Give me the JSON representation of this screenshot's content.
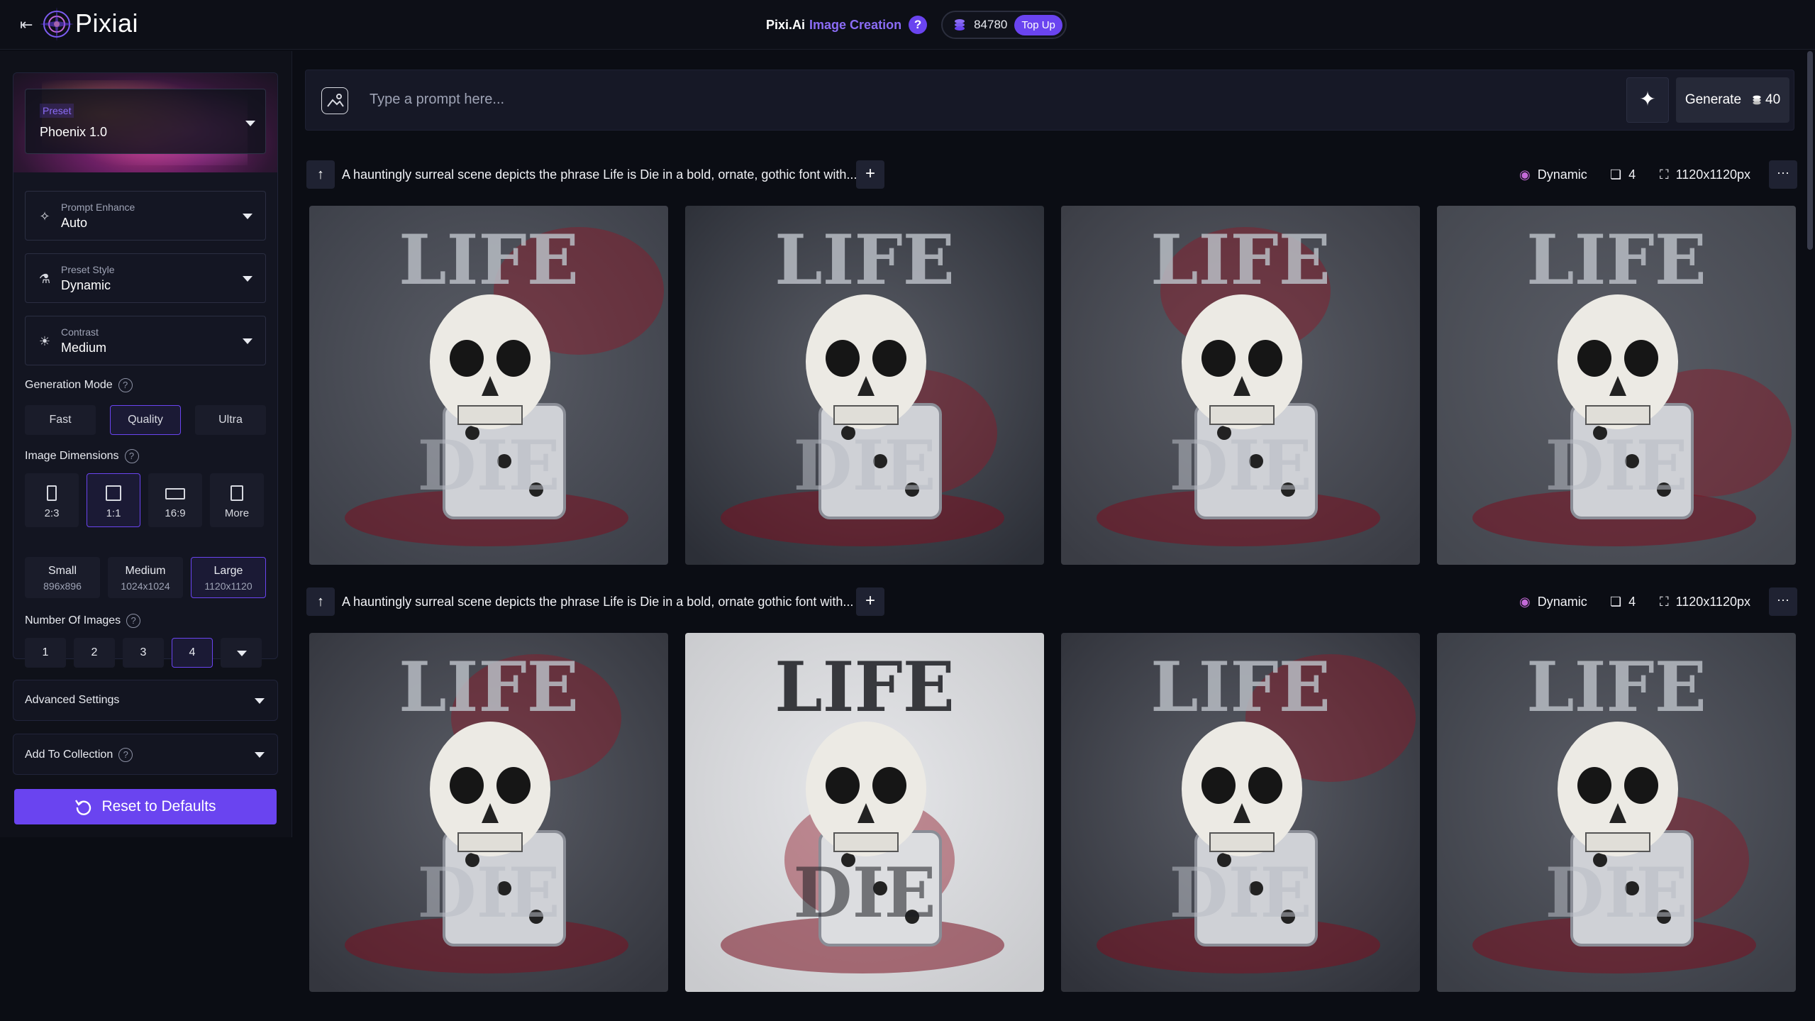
{
  "app": {
    "brand": "Pixiai",
    "title": "Pixi.Ai",
    "subtitle": "Image Creation",
    "help": "?",
    "credits": "84780",
    "topup_label": "Top Up",
    "back_icon": "collapse-left-icon",
    "accent": "#6a44f0"
  },
  "sidebar": {
    "preset": {
      "tag": "Preset",
      "value": "Phoenix 1.0"
    },
    "prompt_enhance": {
      "label": "Prompt Enhance",
      "value": "Auto"
    },
    "preset_style": {
      "label": "Preset Style",
      "value": "Dynamic"
    },
    "contrast": {
      "label": "Contrast",
      "value": "Medium"
    },
    "generation_mode": {
      "label": "Generation Mode",
      "options": [
        "Fast",
        "Quality",
        "Ultra"
      ],
      "selected": "Quality"
    },
    "image_dimensions": {
      "label": "Image Dimensions",
      "options": [
        "2:3",
        "1:1",
        "16:9",
        "More"
      ],
      "selected": "1:1"
    },
    "sizes": [
      {
        "name": "Small",
        "px": "896x896"
      },
      {
        "name": "Medium",
        "px": "1024x1024"
      },
      {
        "name": "Large",
        "px": "1120x1120"
      }
    ],
    "selected_size": "Large",
    "number_of_images": {
      "label": "Number Of Images",
      "options": [
        "1",
        "2",
        "3",
        "4"
      ],
      "selected": "4"
    },
    "advanced_settings": "Advanced Settings",
    "add_to_collection": "Add To Collection",
    "reset_label": "Reset to Defaults"
  },
  "prompt_bar": {
    "placeholder": "Type a prompt here...",
    "generate_label": "Generate",
    "generate_cost": "40"
  },
  "rows": [
    {
      "prompt": "A hauntingly surreal scene depicts the phrase Life is Die in a bold, ornate, gothic font with...",
      "style": "Dynamic",
      "count": "4",
      "size": "1120x1120px",
      "images": [
        "skull-dice-image",
        "skull-dice-image",
        "skull-dice-image",
        "skull-dice-image"
      ]
    },
    {
      "prompt": "A hauntingly surreal scene depicts the phrase Life is Die in a bold, ornate gothic font with...",
      "style": "Dynamic",
      "count": "4",
      "size": "1120x1120px",
      "images": [
        "skull-dice-image",
        "skull-dice-image",
        "skull-dice-image",
        "skull-dice-image"
      ]
    }
  ]
}
